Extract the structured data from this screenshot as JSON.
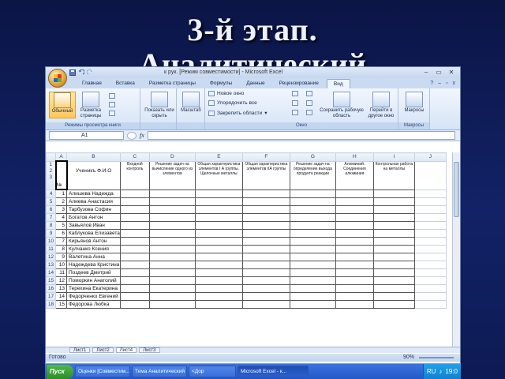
{
  "slide": {
    "title_line1": "3-й этап.",
    "title_line2": "Аналитический"
  },
  "excel": {
    "window_title": "к рук. [Режим совместимости] - Microsoft Excel",
    "tabs": [
      "Главная",
      "Вставка",
      "Разметка страницы",
      "Формулы",
      "Данные",
      "Рецензирование",
      "Вид"
    ],
    "active_tab": "Вид",
    "ribbon": {
      "group_views": "Режимы просмотра книги",
      "btn_normal": "Обычный",
      "btn_page_layout": "Разметка страницы",
      "btn_show_hide": "Показать или скрыть",
      "btn_zoom": "Масштаб",
      "new_window": "Новое окно",
      "arrange_all": "Упорядочить все",
      "freeze_panes": "Закрепить области",
      "btn_save_workspace": "Сохранить рабочую область",
      "btn_switch_windows": "Перейти в другое окно",
      "group_window": "Окно",
      "btn_macros": "Макросы",
      "group_macros": "Макросы"
    },
    "name_box": "A1",
    "fx": "fx",
    "columns": [
      "A",
      "B",
      "C",
      "D",
      "E",
      "F",
      "G",
      "H",
      "I",
      "J"
    ],
    "header_row": {
      "b": "Ученикъ Ф.И.О",
      "c": "Входной контроль",
      "d": "Решение задач на вычисление одного из элементов",
      "e": "Общая характеристика элементов I А группы. Щелочные металлы",
      "f": "Общая характеристика элементов IIА группы",
      "g": "Решение задач на определение выхода продукта реакции",
      "h": "Алюминий. Соединения алюминия",
      "i": "Контрольная работа на металлы"
    },
    "no_label": "№",
    "students": [
      {
        "row": "4",
        "n": "1",
        "name": "Алишева Надежда"
      },
      {
        "row": "5",
        "n": "2",
        "name": "Алиева Анастасия"
      },
      {
        "row": "6",
        "n": "3",
        "name": "Тарбузова Софин"
      },
      {
        "row": "7",
        "n": "4",
        "name": "Богатов Антон"
      },
      {
        "row": "8",
        "n": "5",
        "name": "Завьялов Иван"
      },
      {
        "row": "9",
        "n": "6",
        "name": "Каблукова Елизавета"
      },
      {
        "row": "10",
        "n": "7",
        "name": "Кирьянов Антон"
      },
      {
        "row": "11",
        "n": "8",
        "name": "Кулчанко Ксения"
      },
      {
        "row": "12",
        "n": "9",
        "name": "Валетина Анна"
      },
      {
        "row": "13",
        "n": "10",
        "name": "Надеждева Кристина"
      },
      {
        "row": "14",
        "n": "11",
        "name": "Поздеев Дмитрий"
      },
      {
        "row": "15",
        "n": "12",
        "name": "Поморкин Анатолий"
      },
      {
        "row": "16",
        "n": "13",
        "name": "Терехина Екатерина"
      },
      {
        "row": "17",
        "n": "14",
        "name": "Федорченко Евгений"
      },
      {
        "row": "18",
        "n": "15",
        "name": "Федорова Любка"
      }
    ],
    "sheet_tabs": [
      "Лист1",
      "Лист2",
      "Лист4",
      "Лист3"
    ],
    "status": "Готово",
    "zoom": "90%"
  },
  "taskbar": {
    "start": "Пуск",
    "items": [
      "Оценки [Совместим...",
      "Тема Аналитический",
      "<Дор",
      "Microsoft Excel - к..."
    ],
    "lang": "RU",
    "clock": "19:0"
  }
}
